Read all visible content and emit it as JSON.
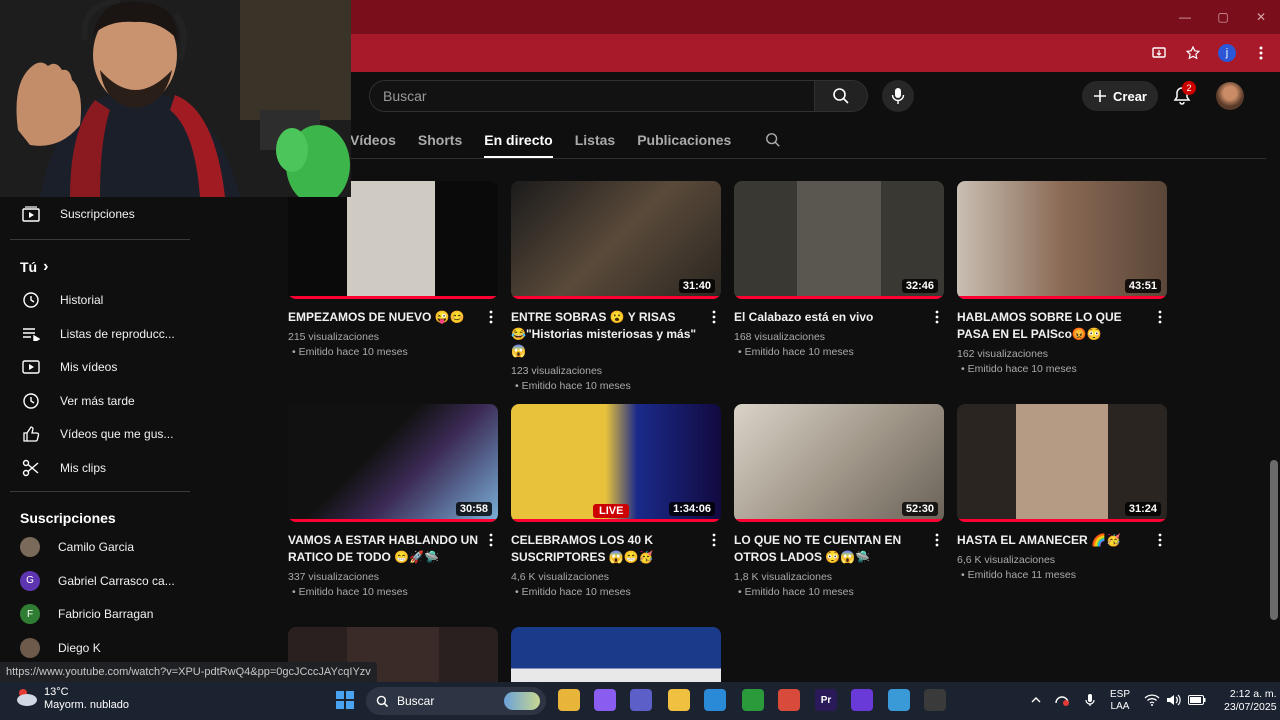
{
  "browser": {
    "window_controls": [
      "—",
      "▢",
      "✕"
    ],
    "profile_initial": "j"
  },
  "header": {
    "search_placeholder": "Buscar",
    "create_label": "Crear",
    "notifications_count": "2"
  },
  "tabs": [
    {
      "label": "Vídeos",
      "active": false
    },
    {
      "label": "Shorts",
      "active": false
    },
    {
      "label": "En directo",
      "active": true
    },
    {
      "label": "Listas",
      "active": false
    },
    {
      "label": "Publicaciones",
      "active": false
    }
  ],
  "sidebar": {
    "subscriptions_link": "Suscripciones",
    "you_heading": "Tú",
    "you_chevron": "›",
    "you_items": [
      {
        "label": "Historial",
        "icon": "history-icon"
      },
      {
        "label": "Listas de reproducc...",
        "icon": "playlists-icon"
      },
      {
        "label": "Mis vídeos",
        "icon": "my-videos-icon"
      },
      {
        "label": "Ver más tarde",
        "icon": "watch-later-icon"
      },
      {
        "label": "Vídeos que me gus...",
        "icon": "like-icon"
      },
      {
        "label": "Mis clips",
        "icon": "clips-icon"
      }
    ],
    "subs_heading": "Suscripciones",
    "subs": [
      {
        "name": "Camilo Garcia",
        "initial": "",
        "color": "#7a6a5a"
      },
      {
        "name": "Gabriel Carrasco ca...",
        "initial": "G",
        "color": "#5e35b1"
      },
      {
        "name": "Fabricio Barragan",
        "initial": "F",
        "color": "#2e7d32"
      },
      {
        "name": "Diego K",
        "initial": "",
        "color": "#6d5a4a"
      }
    ]
  },
  "videos": [
    {
      "title": "EMPEZAMOS DE NUEVO 😜😊",
      "views": "215 visualizaciones",
      "date": "Emitido hace 10 meses",
      "duration": "",
      "thumb": "linear-gradient(90deg,#0a0a0a 0 28%,#cfcac2 28% 70%,#0a0a0a 70%)",
      "live": ""
    },
    {
      "title": "ENTRE SOBRAS 😮 Y RISAS 😂\"Historias misteriosas y más\" 😱",
      "views": "123 visualizaciones",
      "date": "Emitido hace 10 meses",
      "duration": "31:40",
      "thumb": "linear-gradient(135deg,#1b1b1b,#5a4a3a 50%,#2a2620)",
      "live": ""
    },
    {
      "title": "El Calabazo está en vivo",
      "views": "168 visualizaciones",
      "date": "Emitido hace 10 meses",
      "duration": "32:46",
      "thumb": "linear-gradient(90deg,#3a3832 0 30%,#5a5750 30% 70%,#3a3832 70%)",
      "live": ""
    },
    {
      "title": "HABLAMOS SOBRE LO QUE PASA EN EL PAISco😡😳",
      "views": "162 visualizaciones",
      "date": "Emitido hace 10 meses",
      "duration": "43:51",
      "thumb": "linear-gradient(90deg,#c9bfb3,#8a6a55 50%,#5a4638)",
      "live": ""
    },
    {
      "title": "VAMOS A ESTAR HABLANDO UN RATICO DE TODO 😁🚀🛸",
      "views": "337 visualizaciones",
      "date": "Emitido hace 10 meses",
      "duration": "30:58",
      "thumb": "linear-gradient(135deg,#111 0 40%,#3a2a55 60%,#7ab0d8)",
      "live": ""
    },
    {
      "title": "CELEBRAMOS LOS 40 K SUSCRIPTORES 😱😁🥳",
      "views": "4,6 K visualizaciones",
      "date": "Emitido hace 10 meses",
      "duration": "1:34:06",
      "thumb": "linear-gradient(90deg,#e8c23a 0 45%,#1a2a8a 60%,#120a40)",
      "live": "LIVE"
    },
    {
      "title": "LO QUE NO TE CUENTAN EN OTROS LADOS 😳😱🛸",
      "views": "1,8 K visualizaciones",
      "date": "Emitido hace 10 meses",
      "duration": "52:30",
      "thumb": "linear-gradient(135deg,#d9d3c8,#a39a8c 50%,#6a6258)",
      "live": ""
    },
    {
      "title": "HASTA EL AMANECER 🌈🥳",
      "views": "6,6 K visualizaciones",
      "date": "Emitido hace 11 meses",
      "duration": "31:24",
      "thumb": "linear-gradient(90deg,#2a2520 0 28%,#b59a84 28% 72%,#2a2520 72%)",
      "live": ""
    },
    {
      "title": "",
      "views": "",
      "date": "",
      "duration": "",
      "thumb": "linear-gradient(90deg,#2a2020 0 28%,#3a2a28 28% 72%,#2a2020 72%)",
      "live": ""
    },
    {
      "title": "",
      "views": "",
      "date": "",
      "duration": "",
      "thumb": "linear-gradient(180deg,#1a3a8a 0 35%,#e8e8e8 35%)",
      "live": ""
    }
  ],
  "status_url": "https://www.youtube.com/watch?v=XPU-pdtRwQ4&pp=0gcJCccJAYcqIYzv",
  "taskbar": {
    "temperature": "13°C",
    "weather_desc": "Mayorm. nublado",
    "search_label": "Buscar",
    "lang_top": "ESP",
    "lang_bottom": "LAA",
    "time": "2:12 a. m.",
    "date": "23/07/2025",
    "apps": [
      {
        "icon": "file-explorer-icon",
        "label": "",
        "color": "#e8b43a"
      },
      {
        "icon": "copilot-icon",
        "label": "",
        "color": "#8a5cf0"
      },
      {
        "icon": "teams-icon",
        "label": "",
        "color": "#5b5fc7"
      },
      {
        "icon": "folder-icon",
        "label": "",
        "color": "#f0c040"
      },
      {
        "icon": "store-icon",
        "label": "",
        "color": "#2a8ad8"
      },
      {
        "icon": "xbox-icon",
        "label": "",
        "color": "#2a9a3a"
      },
      {
        "icon": "chrome-icon",
        "label": "",
        "color": "#d84a3a"
      },
      {
        "icon": "premiere-icon",
        "label": "Pr",
        "color": "#2a1a5a"
      },
      {
        "icon": "obs-icon",
        "label": "",
        "color": "#6a3ad8"
      },
      {
        "icon": "chrome-active-icon",
        "label": "",
        "color": "#3a9ad8"
      },
      {
        "icon": "recorder-icon",
        "label": "",
        "color": "#3a3a3a"
      }
    ]
  }
}
